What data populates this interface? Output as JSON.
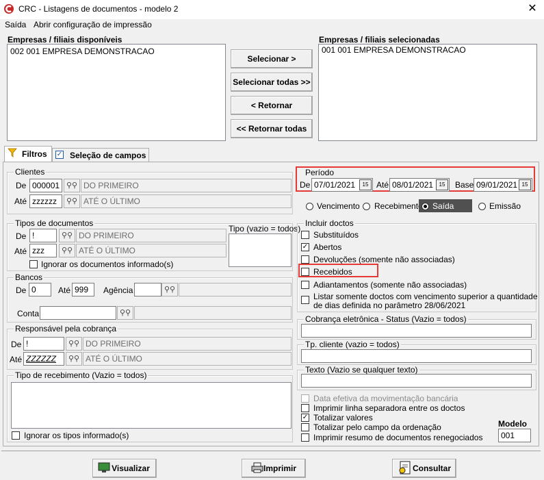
{
  "window": {
    "title": "CRC - Listagens de documentos - modelo 2",
    "close": "✕"
  },
  "menu": {
    "exit": "Saída",
    "config": "Abrir configuração de impressão"
  },
  "companies": {
    "available_label": "Empresas / filiais disponíveis",
    "available": [
      "002 001 EMPRESA DEMONSTRACAO"
    ],
    "selected_label": "Empresas / filiais selecionadas",
    "selected": [
      "001 001 EMPRESA DEMONSTRACAO"
    ],
    "btn_select": "Selecionar >",
    "btn_select_all": "Selecionar todas >>",
    "btn_return": "< Retornar",
    "btn_return_all": "<< Retornar todas"
  },
  "tabs": {
    "filters": "Filtros",
    "fields": "Seleção de campos"
  },
  "clients": {
    "label": "Clientes",
    "from_label": "De",
    "from_value": "000001",
    "from_desc": "DO PRIMEIRO",
    "to_label": "Até",
    "to_value": "zzzzzz",
    "to_desc": "ATÉ O ÚLTIMO"
  },
  "period": {
    "label": "Período",
    "from_label": "De",
    "from": "07/01/2021",
    "to_label": "Até",
    "to": "08/01/2021",
    "base_label": "Base",
    "base": "09/01/2021",
    "options": [
      "Vencimento",
      "Recebimento",
      "Saída",
      "Emissão"
    ],
    "selected": "Saída"
  },
  "doc_types": {
    "label": "Tipos de documentos",
    "from_label": "De",
    "from_value": "!",
    "from_desc": "DO PRIMEIRO",
    "to_label": "Até",
    "to_value": "zzz",
    "to_desc": "ATÉ O ÚLTIMO",
    "type_label": "Tipo (vazio = todos)",
    "ignore": "Ignorar os documentos informado(s)"
  },
  "include_docs": {
    "label": "Incluir doctos",
    "items": [
      {
        "label": "Substituídos",
        "checked": false
      },
      {
        "label": "Abertos",
        "checked": true
      },
      {
        "label": "Devoluções (somente não associadas)",
        "checked": false
      },
      {
        "label": "Recebidos",
        "checked": false
      },
      {
        "label": "Adiantamentos (somente não associadas)",
        "checked": false
      },
      {
        "label": "Listar somente doctos com vencimento superior a quantidade",
        "checked": false
      }
    ],
    "note_line2": "de dias definida no parâmetro 28/06/2021"
  },
  "banks": {
    "label": "Bancos",
    "from_label": "De",
    "from_value": "0",
    "to_label": "Até",
    "to_value": "999",
    "agency_label": "Agência",
    "account_label": "Conta"
  },
  "billing_status": {
    "label": "Cobrança eletrônica - Status (Vazio = todos)"
  },
  "responsible": {
    "label": "Responsável pela cobrança",
    "from_label": "De",
    "from_value": "!",
    "from_desc": "DO PRIMEIRO",
    "to_label": "Até",
    "to_value": "ZZZZZZ",
    "to_desc": "ATÉ O ÚLTIMO"
  },
  "client_type": {
    "label": "Tp. cliente (vazio = todos)"
  },
  "text_filter": {
    "label": "Texto (Vazio se qualquer texto)"
  },
  "receipt_type": {
    "label": "Tipo de recebimento (Vazio = todos)",
    "ignore": "Ignorar os tipos informado(s)"
  },
  "options": [
    {
      "label": "Data efetiva da movimentação bancária",
      "checked": false,
      "disabled": true
    },
    {
      "label": "Imprimir linha separadora entre os doctos",
      "checked": false,
      "disabled": false
    },
    {
      "label": "Totalizar valores",
      "checked": true,
      "disabled": false
    },
    {
      "label": "Totalizar pelo campo da ordenação",
      "checked": false,
      "disabled": false
    },
    {
      "label": "Imprimir resumo de documentos renegociados",
      "checked": false,
      "disabled": false
    }
  ],
  "model": {
    "label": "Modelo",
    "value": "001"
  },
  "footer": {
    "view": "Visualizar",
    "print": "Imprimir",
    "query": "Consultar"
  }
}
